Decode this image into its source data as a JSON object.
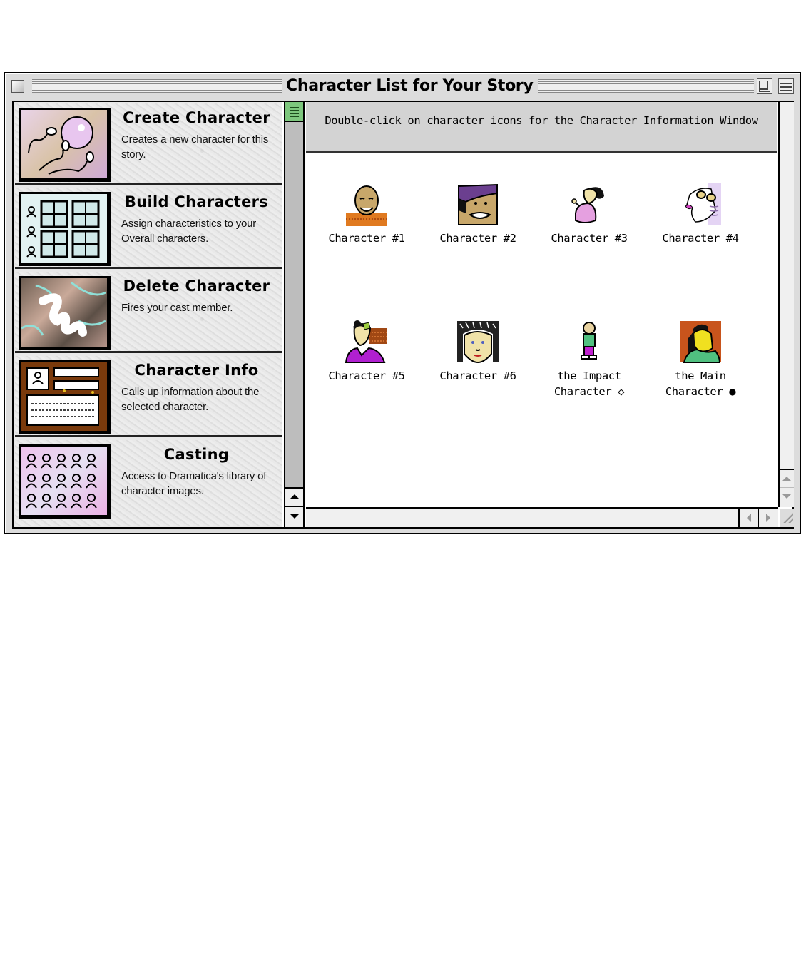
{
  "window": {
    "title": "Character List for Your Story"
  },
  "tools": [
    {
      "title": "Create Character",
      "description": "Creates a new character for this story.",
      "icon": "spermatozoa-ovum-icon"
    },
    {
      "title": "Build Characters",
      "description": "Assign characteristics to your Overall characters.",
      "icon": "character-grid-icon"
    },
    {
      "title": "Delete Character",
      "description": "Fires your cast member.",
      "icon": "scribble-erase-icon"
    },
    {
      "title": "Character Info",
      "description": "Calls up information about the selected character.",
      "icon": "info-card-icon"
    },
    {
      "title": "Casting",
      "description": "Access to Dramatica's library of character images.",
      "icon": "people-library-icon"
    }
  ],
  "instructions": "Double-click on character icons for the Character Information Window",
  "characters": [
    {
      "label": "Character #1",
      "icon": "bald-man-portrait-icon"
    },
    {
      "label": "Character #2",
      "icon": "woman-purple-hat-portrait-icon"
    },
    {
      "label": "Character #3",
      "icon": "child-pink-dress-icon"
    },
    {
      "label": "Character #4",
      "icon": "elderly-woman-glasses-icon"
    },
    {
      "label": "Character #5",
      "icon": "woman-purple-shirt-icon"
    },
    {
      "label": "Character #6",
      "icon": "curly-hair-woman-portrait-icon"
    },
    {
      "label": "the Impact\nCharacter ◇",
      "icon": "small-boy-green-shirt-icon"
    },
    {
      "label": "the Main\nCharacter ●",
      "icon": "yellow-man-orange-bg-icon"
    }
  ],
  "colors": {
    "window_bg": "#dcdcdc",
    "scroll_thumb": "#7dc77d",
    "instruction_bar": "#d3d3d3"
  }
}
